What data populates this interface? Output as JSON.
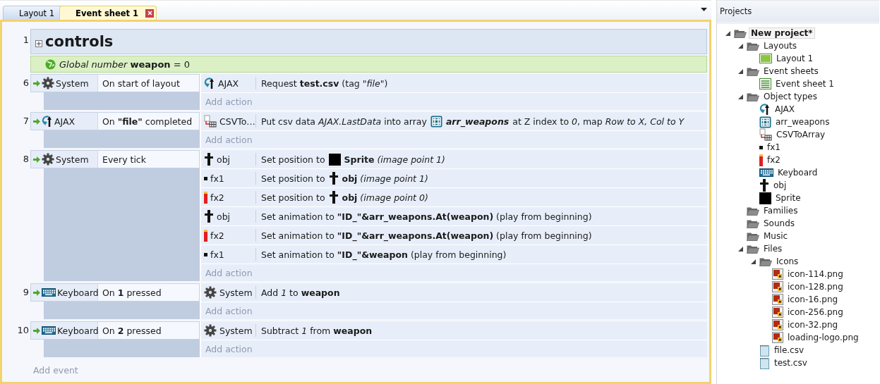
{
  "tabs": [
    {
      "label": "Layout 1",
      "selected": false
    },
    {
      "label": "Event sheet 1",
      "selected": true
    }
  ],
  "events": [
    {
      "kind": "group",
      "number": "1",
      "title": "controls"
    },
    {
      "kind": "variable",
      "text": "*Global number* **weapon** = 0"
    },
    {
      "kind": "event",
      "number": "6",
      "conditions": [
        {
          "kind": "system",
          "object": "System",
          "parts": [
            {
              "kind": "text",
              "text": "On start of layout"
            }
          ]
        }
      ],
      "actions": [
        {
          "kind": "ajax",
          "object": "AJAX",
          "parts": [
            {
              "kind": "text",
              "text": "Request **test.csv** (tag *\"file\"*)"
            }
          ]
        }
      ],
      "add_action": "Add action"
    },
    {
      "kind": "event",
      "number": "7",
      "conditions": [
        {
          "kind": "ajax",
          "object": "AJAX",
          "parts": [
            {
              "kind": "text",
              "text": "On **\"file\"** completed"
            }
          ]
        }
      ],
      "actions": [
        {
          "kind": "csv",
          "object": "CSVTo…",
          "parts": [
            {
              "kind": "text",
              "text": "Put csv data *AJAX.LastData* into array"
            },
            {
              "kind": "array"
            },
            {
              "kind": "reference",
              "text": "arr_weapons"
            },
            {
              "kind": "text",
              "text": "at Z index to *0*, map *Row to X, Col to Y*"
            }
          ]
        }
      ],
      "add_action": "Add action"
    },
    {
      "kind": "event",
      "number": "8",
      "conditions": [
        {
          "kind": "system",
          "object": "System",
          "parts": [
            {
              "kind": "text",
              "text": "Every tick"
            }
          ]
        }
      ],
      "actions": [
        {
          "kind": "obj",
          "object": "obj",
          "parts": [
            {
              "kind": "text",
              "text": "Set position to"
            },
            {
              "kind": "square"
            },
            {
              "kind": "text",
              "text": "**Sprite** *(image point 1)*"
            }
          ]
        },
        {
          "kind": "dot",
          "object": "fx1",
          "parts": [
            {
              "kind": "text",
              "text": "Set position to"
            },
            {
              "kind": "obj"
            },
            {
              "kind": "text",
              "text": "**obj** *(image point 1)*"
            }
          ]
        },
        {
          "kind": "bar",
          "object": "fx2",
          "parts": [
            {
              "kind": "text",
              "text": "Set position to"
            },
            {
              "kind": "obj"
            },
            {
              "kind": "text",
              "text": "**obj** *(image point 0)*"
            }
          ]
        },
        {
          "kind": "obj",
          "object": "obj",
          "parts": [
            {
              "kind": "text",
              "text": "Set animation to **\"ID_\"&arr_weapons.At(weapon)** (play from beginning)"
            }
          ]
        },
        {
          "kind": "bar",
          "object": "fx2",
          "parts": [
            {
              "kind": "text",
              "text": "Set animation to **\"ID_\"&arr_weapons.At(weapon)** (play from beginning)"
            }
          ]
        },
        {
          "kind": "dot",
          "object": "fx1",
          "parts": [
            {
              "kind": "text",
              "text": "Set animation to **\"ID_\"&weapon** (play from beginning)"
            }
          ]
        }
      ],
      "add_action": "Add action"
    },
    {
      "kind": "event",
      "number": "9",
      "conditions": [
        {
          "kind": "keyboard",
          "object": "Keyboard",
          "parts": [
            {
              "kind": "text",
              "text": "On **1** pressed"
            }
          ]
        }
      ],
      "actions": [
        {
          "kind": "system",
          "object": "System",
          "parts": [
            {
              "kind": "text",
              "text": "Add *1* to **weapon**"
            }
          ]
        }
      ],
      "add_action": "Add action"
    },
    {
      "kind": "event",
      "number": "10",
      "conditions": [
        {
          "kind": "keyboard",
          "object": "Keyboard",
          "parts": [
            {
              "kind": "text",
              "text": "On **2** pressed"
            }
          ]
        }
      ],
      "actions": [
        {
          "kind": "system",
          "object": "System",
          "parts": [
            {
              "kind": "text",
              "text": "Subtract *1* from **weapon**"
            }
          ]
        }
      ],
      "add_action": "Add action"
    }
  ],
  "add_event": "Add event",
  "projects": {
    "title": "Projects",
    "tree": [
      {
        "label": "New project*",
        "kind": "folder",
        "expanded": true,
        "children": [
          {
            "label": "Layouts",
            "kind": "folder",
            "expanded": true,
            "children": [
              {
                "label": "Layout 1",
                "kind": "layout"
              }
            ]
          },
          {
            "label": "Event sheets",
            "kind": "folder",
            "expanded": true,
            "children": [
              {
                "label": "Event sheet 1",
                "kind": "sheet"
              }
            ]
          },
          {
            "label": "Object types",
            "kind": "folder",
            "expanded": true,
            "children": [
              {
                "label": "AJAX",
                "kind": "ajax"
              },
              {
                "label": "arr_weapons",
                "kind": "array"
              },
              {
                "label": "CSVToArray",
                "kind": "csv"
              },
              {
                "label": "fx1",
                "kind": "dot"
              },
              {
                "label": "fx2",
                "kind": "bar"
              },
              {
                "label": "Keyboard",
                "kind": "keyboard"
              },
              {
                "label": "obj",
                "kind": "obj"
              },
              {
                "label": "Sprite",
                "kind": "square"
              }
            ]
          },
          {
            "label": "Families",
            "kind": "folder"
          },
          {
            "label": "Sounds",
            "kind": "folder"
          },
          {
            "label": "Music",
            "kind": "folder"
          },
          {
            "label": "Files",
            "kind": "folder",
            "expanded": true,
            "children": [
              {
                "label": "Icons",
                "kind": "folder",
                "expanded": true,
                "children": [
                  {
                    "label": "icon-114.png",
                    "kind": "image"
                  },
                  {
                    "label": "icon-128.png",
                    "kind": "image"
                  },
                  {
                    "label": "icon-16.png",
                    "kind": "image"
                  },
                  {
                    "label": "icon-256.png",
                    "kind": "image"
                  },
                  {
                    "label": "icon-32.png",
                    "kind": "image"
                  },
                  {
                    "label": "loading-logo.png",
                    "kind": "image"
                  }
                ]
              },
              {
                "label": "file.csv",
                "kind": "textfile"
              },
              {
                "label": "test.csv",
                "kind": "textfile"
              }
            ]
          }
        ]
      }
    ]
  }
}
